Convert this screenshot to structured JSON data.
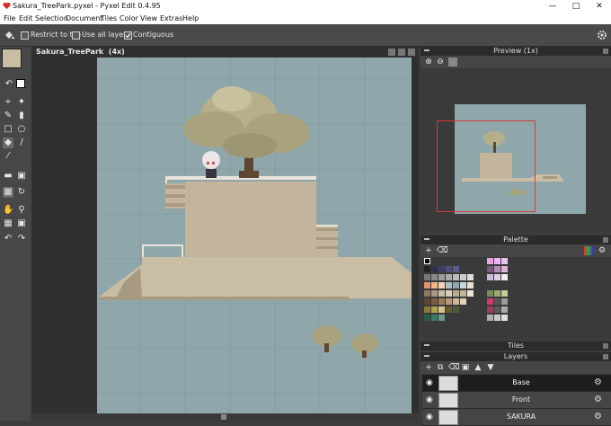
{
  "window": {
    "title": "Sakura_TreePark.pyxel - Pyxel Edit 0.4.95"
  },
  "menu": [
    "File",
    "Edit",
    "Selection",
    "Document",
    "Tiles",
    "Color",
    "View",
    "Extras",
    "Help"
  ],
  "options": {
    "restrict_label": "Restrict to tile",
    "all_layers_label": "Use all layers",
    "contiguous_label": "Contiguous",
    "contiguous_checked": true
  },
  "document": {
    "title": "Sakura_TreePark",
    "zoom": "(4x)"
  },
  "panels": {
    "preview": "Preview (1x)",
    "palette": "Palette",
    "tiles": "Tiles",
    "layers": "Layers"
  },
  "layers": [
    {
      "name": "Base",
      "selected": true
    },
    {
      "name": "Front",
      "selected": false
    },
    {
      "name": "SAKURA",
      "selected": false
    }
  ],
  "colors": {
    "sky": "#8fa7ab",
    "stone": "#c9bda4",
    "stone_dark": "#a89a80",
    "tree": "#b5b08a",
    "trunk": "#5e4632"
  }
}
